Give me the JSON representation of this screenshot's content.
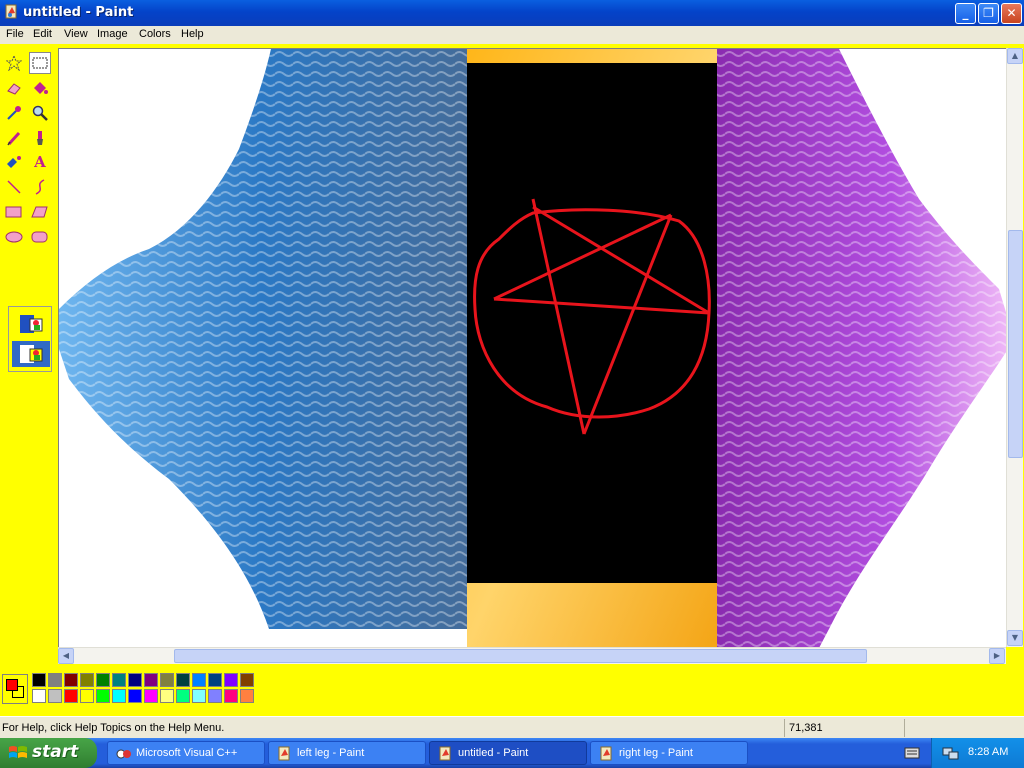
{
  "window": {
    "title": "untitled - Paint",
    "minimize": "_",
    "maximize": "❐",
    "close": "✕"
  },
  "menu": [
    "File",
    "Edit",
    "View",
    "Image",
    "Colors",
    "Help"
  ],
  "tools": [
    {
      "name": "free-form-select-tool",
      "icon": "star-select-icon"
    },
    {
      "name": "select-tool",
      "icon": "rect-select-icon",
      "selected": true
    },
    {
      "name": "eraser-tool",
      "icon": "eraser-icon"
    },
    {
      "name": "fill-tool",
      "icon": "fill-bucket-icon"
    },
    {
      "name": "pick-color-tool",
      "icon": "eyedropper-icon"
    },
    {
      "name": "magnifier-tool",
      "icon": "magnifier-icon"
    },
    {
      "name": "pencil-tool",
      "icon": "pencil-icon"
    },
    {
      "name": "brush-tool",
      "icon": "brush-icon"
    },
    {
      "name": "airbrush-tool",
      "icon": "airbrush-icon"
    },
    {
      "name": "text-tool",
      "icon": "text-icon"
    },
    {
      "name": "line-tool",
      "icon": "line-icon"
    },
    {
      "name": "curve-tool",
      "icon": "curve-icon"
    },
    {
      "name": "rectangle-tool",
      "icon": "rectangle-icon"
    },
    {
      "name": "polygon-tool",
      "icon": "polygon-icon"
    },
    {
      "name": "ellipse-tool",
      "icon": "ellipse-icon"
    },
    {
      "name": "rounded-rectangle-tool",
      "icon": "rounded-rect-icon"
    }
  ],
  "colors": {
    "foreground": "#ff0000",
    "background": "#ffff00",
    "palette_top": [
      "#000000",
      "#808080",
      "#800000",
      "#808000",
      "#008000",
      "#008080",
      "#000080",
      "#800080",
      "#808040",
      "#004040",
      "#0080ff",
      "#004080",
      "#8000ff",
      "#804000"
    ],
    "palette_bottom": [
      "#ffffff",
      "#c0c0c0",
      "#ff0000",
      "#ffff00",
      "#00ff00",
      "#00ffff",
      "#0000ff",
      "#ff00ff",
      "#ffff80",
      "#00ff80",
      "#80ffff",
      "#8080ff",
      "#ff0080",
      "#ff8040"
    ]
  },
  "status": {
    "help_text": "For Help, click Help Topics on the Help Menu.",
    "coords": "71,381"
  },
  "taskbar": {
    "start": "start",
    "tasks": [
      {
        "label": "Microsoft Visual C++",
        "icon": "visual-cpp-icon",
        "active": false
      },
      {
        "label": "left leg - Paint",
        "icon": "paint-icon",
        "active": false
      },
      {
        "label": "untitled - Paint",
        "icon": "paint-icon",
        "active": true
      },
      {
        "label": "right leg - Paint",
        "icon": "paint-icon",
        "active": false
      }
    ],
    "time": "8:28 AM"
  }
}
